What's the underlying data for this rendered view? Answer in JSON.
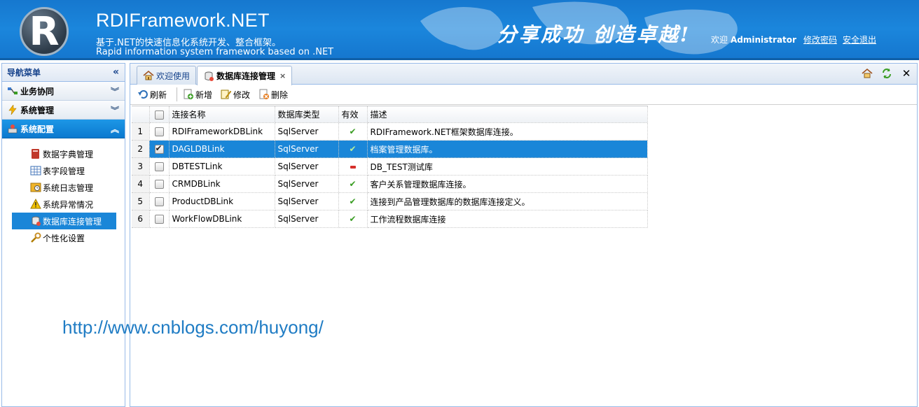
{
  "header": {
    "logo_letter": "R",
    "title": "RDIFramework.NET",
    "subtitle_cn": "基于.NET的快速信息化系统开发、整合框架。",
    "subtitle_en": "Rapid information system framework based on .NET",
    "slogan": "分享成功 创造卓越!",
    "welcome": "欢迎",
    "username": "Administrator",
    "change_password": "修改密码",
    "logout": "安全退出"
  },
  "nav": {
    "title": "导航菜单",
    "sections": [
      {
        "label": "业务协同",
        "icon": "workflow-icon",
        "active": false
      },
      {
        "label": "系统管理",
        "icon": "lightning-icon",
        "active": false
      },
      {
        "label": "系统配置",
        "icon": "config-icon",
        "active": true
      }
    ],
    "items": [
      {
        "label": "数据字典管理",
        "icon": "book-icon"
      },
      {
        "label": "表字段管理",
        "icon": "table-icon"
      },
      {
        "label": "系统日志管理",
        "icon": "log-icon"
      },
      {
        "label": "系统异常情况",
        "icon": "warning-icon"
      },
      {
        "label": "数据库连接管理",
        "icon": "database-icon",
        "selected": true
      },
      {
        "label": "个性化设置",
        "icon": "wrench-icon"
      }
    ]
  },
  "tabs": [
    {
      "label": "欢迎使用",
      "icon": "home-icon",
      "active": false
    },
    {
      "label": "数据库连接管理",
      "icon": "database-icon",
      "active": true,
      "closable": true
    }
  ],
  "toolbar": {
    "refresh": "刷新",
    "add": "新增",
    "edit": "修改",
    "delete": "删除"
  },
  "grid": {
    "columns": [
      "连接名称",
      "数据库类型",
      "有效",
      "描述"
    ],
    "rows": [
      {
        "num": "1",
        "checked": false,
        "name": "RDIFrameworkDBLink",
        "type": "SqlServer",
        "valid": true,
        "desc": "RDIFramework.NET框架数据库连接。",
        "selected": false
      },
      {
        "num": "2",
        "checked": true,
        "name": "DAGLDBLink",
        "type": "SqlServer",
        "valid": true,
        "desc": "档案管理数据库。",
        "selected": true
      },
      {
        "num": "3",
        "checked": false,
        "name": "DBTESTLink",
        "type": "SqlServer",
        "valid": false,
        "desc": "DB_TEST测试库",
        "selected": false
      },
      {
        "num": "4",
        "checked": false,
        "name": "CRMDBLink",
        "type": "SqlServer",
        "valid": true,
        "desc": "客户关系管理数据库连接。",
        "selected": false
      },
      {
        "num": "5",
        "checked": false,
        "name": "ProductDBLink",
        "type": "SqlServer",
        "valid": true,
        "desc": "连接到产品管理数据库的数据库连接定义。",
        "selected": false
      },
      {
        "num": "6",
        "checked": false,
        "name": "WorkFlowDBLink",
        "type": "SqlServer",
        "valid": true,
        "desc": "工作流程数据库连接",
        "selected": false
      }
    ]
  },
  "watermark": "http://www.cnblogs.com/huyong/",
  "colors": {
    "banner": "#1678cf",
    "selection": "#1a86d8",
    "border": "#99bbe8"
  }
}
